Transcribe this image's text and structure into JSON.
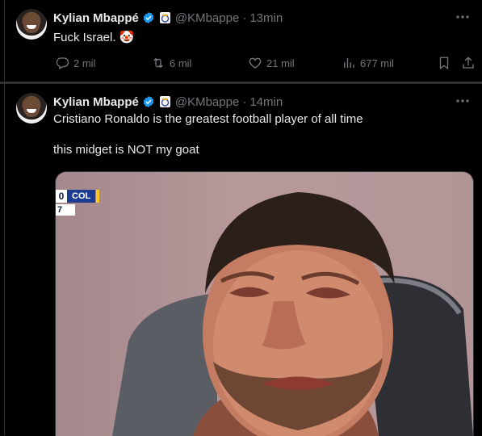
{
  "tweets": [
    {
      "author": "Kylian Mbappé",
      "handle": "@KMbappe",
      "time": "13min",
      "text_lines": [
        "Fuck Israel. 🤡"
      ],
      "stats": {
        "replies": "2 mil",
        "reposts": "6 mil",
        "likes": "21 mil",
        "views": "677 mil"
      }
    },
    {
      "author": "Kylian Mbappé",
      "handle": "@KMbappe",
      "time": "14min",
      "text_lines": [
        "Cristiano Ronaldo is the greatest football player of all time",
        "this midget is NOT my goat"
      ],
      "media": {
        "scoreboard_score": "0",
        "scoreboard_team": "COL",
        "scoreboard_minute": "7"
      }
    }
  ],
  "colors": {
    "background": "#000000",
    "text": "#e7e9ea",
    "muted": "#71767b",
    "verified": "#1d9bf0",
    "separator": "#2f3336"
  },
  "icons": [
    "verified-badge-icon",
    "real-madrid-crest-icon",
    "more-icon",
    "reply-icon",
    "repost-icon",
    "like-icon",
    "views-icon",
    "bookmark-icon",
    "share-icon"
  ]
}
